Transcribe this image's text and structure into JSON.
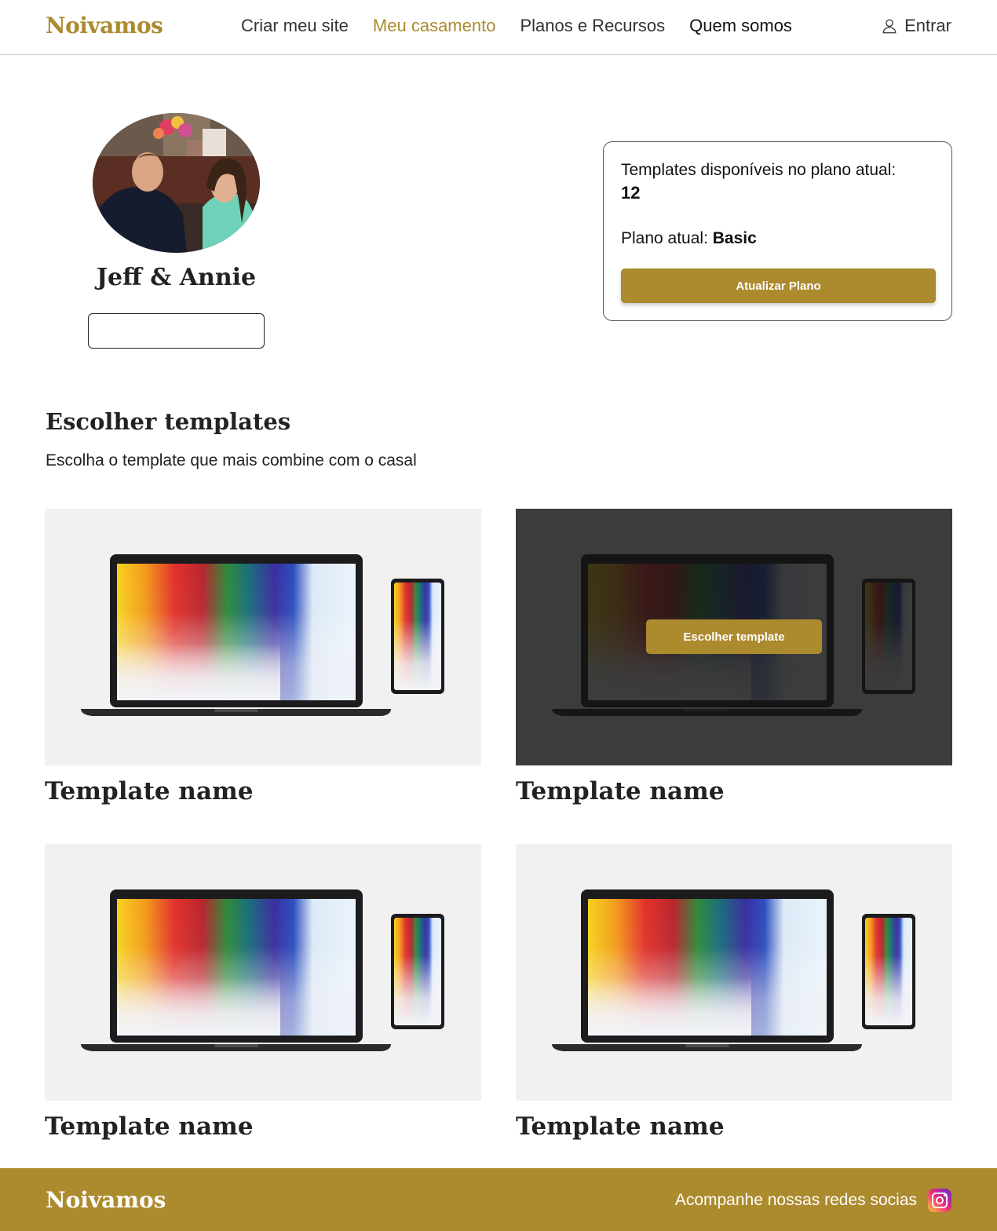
{
  "nav": {
    "brand": "Noivamos",
    "links": [
      "Criar meu site",
      "Meu casamento",
      "Planos e Recursos",
      "Quem somos"
    ],
    "login": "Entrar"
  },
  "profile": {
    "couple_name": "Jeff & Annie"
  },
  "plan": {
    "available_label": "Templates disponíveis no plano atual:",
    "available_count": "12",
    "current_label": "Plano atual:",
    "current_value": "Basic",
    "upgrade_button": "Atualizar Plano"
  },
  "templates_section": {
    "title": "Escolher templates",
    "subtitle": "Escolha o template que mais combine com o casal",
    "choose_button": "Escolher template",
    "items": [
      {
        "name": "Template name"
      },
      {
        "name": "Template name"
      },
      {
        "name": "Template name"
      },
      {
        "name": "Template name"
      }
    ]
  },
  "footer": {
    "brand": "Noivamos",
    "social_text": "Acompanhe nossas redes socias"
  },
  "colors": {
    "accent": "#ac8a2e",
    "dark_overlay": "#2b2b2b",
    "thumb_bg": "#f1f1f1"
  }
}
